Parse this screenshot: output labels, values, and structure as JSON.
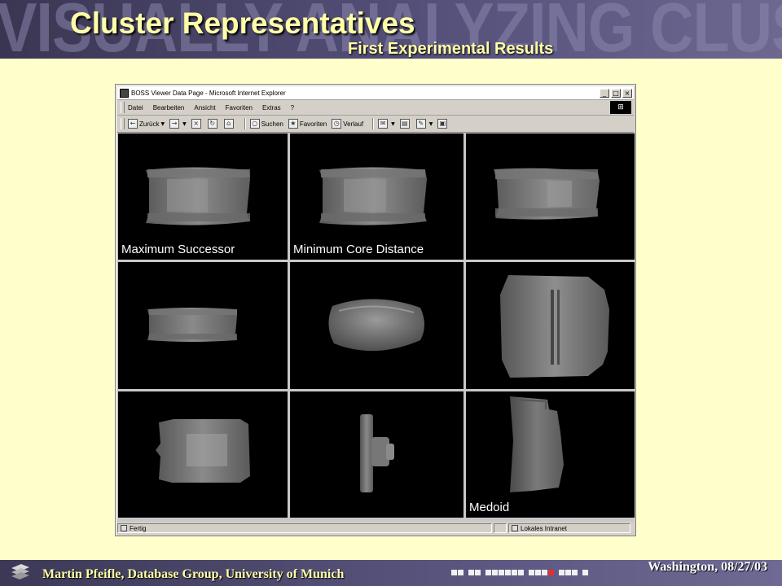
{
  "slide": {
    "header_background_text": "VISUALLY ANALYZING CLUSTER HIERARCHIES",
    "title": "Cluster Representatives",
    "subtitle": "First Experimental Results",
    "footer_author": "Martin Pfeifle, Database Group, University of Munich",
    "footer_date": "Washington, 08/27/03",
    "progress_groups": [
      2,
      2,
      6,
      4,
      3,
      1
    ],
    "progress_current_index": 13
  },
  "browser": {
    "window_title": "BOSS Viewer Data Page - Microsoft Internet Explorer",
    "window_buttons": [
      "_",
      "□",
      "×"
    ],
    "menu": [
      "Datei",
      "Bearbeiten",
      "Ansicht",
      "Favoriten",
      "Extras",
      "?"
    ],
    "toolbar": {
      "back": "Zurück",
      "search": "Suchen",
      "favorites": "Favoriten",
      "history": "Verlauf"
    },
    "status": {
      "text": "Fertig",
      "zone": "Lokales Intranet"
    }
  },
  "grid": {
    "cells": [
      {
        "label": "Maximum Successor",
        "shape": "ring-wide"
      },
      {
        "label": "Minimum Core Distance",
        "shape": "ring-wide"
      },
      {
        "label": "",
        "shape": "ring-wide-small"
      },
      {
        "label": "",
        "shape": "ring-thin"
      },
      {
        "label": "",
        "shape": "bowl"
      },
      {
        "label": "",
        "shape": "drum"
      },
      {
        "label": "",
        "shape": "spool"
      },
      {
        "label": "",
        "shape": "flange"
      },
      {
        "label": "Medoid",
        "shape": "wedge"
      }
    ]
  },
  "colors": {
    "slide_background": "#ffffcc",
    "title_color": "#ffffa8",
    "header_bg": "#4a4668",
    "part_gray": "#7a7a7a"
  }
}
